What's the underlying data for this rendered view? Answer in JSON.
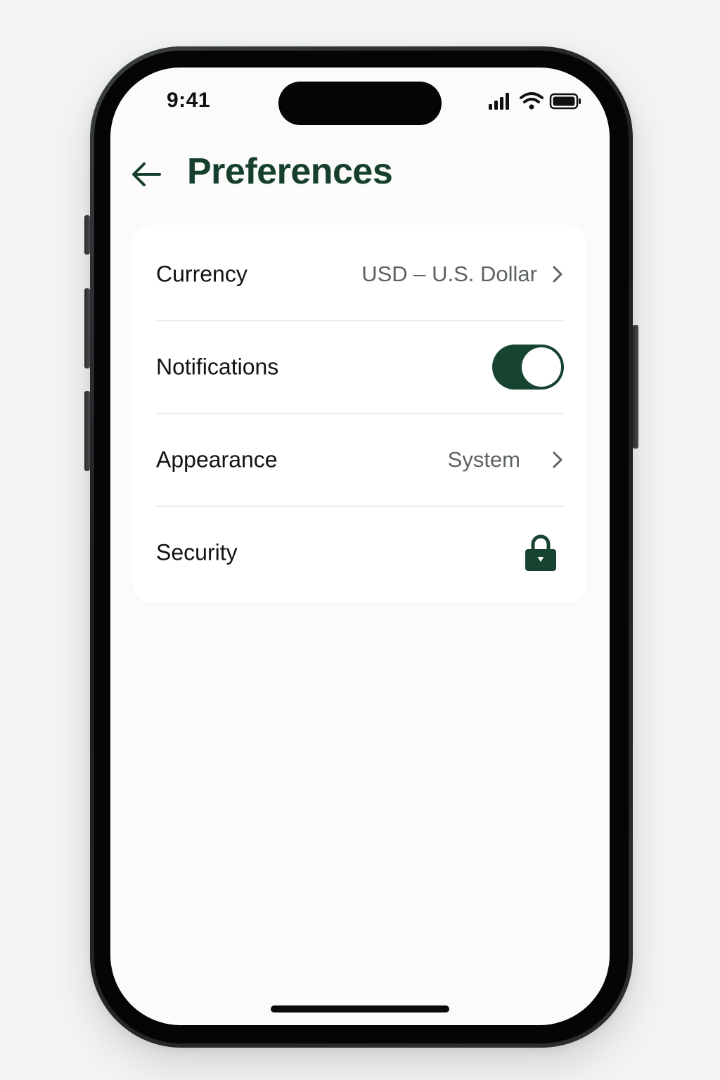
{
  "status_bar": {
    "time": "9:41"
  },
  "header": {
    "title": "Preferences",
    "back_icon": "arrow-left-icon"
  },
  "settings": [
    {
      "label": "Currency",
      "value": "USD – U.S. Dollar",
      "control": "chevron"
    },
    {
      "label": "Notifications",
      "control": "toggle",
      "enabled": true
    },
    {
      "label": "Appearance",
      "value": "System",
      "control": "chevron"
    },
    {
      "label": "Security",
      "control": "lock-icon"
    }
  ],
  "colors": {
    "accent": "#17402c",
    "toggle_on": "#174430",
    "secondary_text": "#5d6360"
  }
}
